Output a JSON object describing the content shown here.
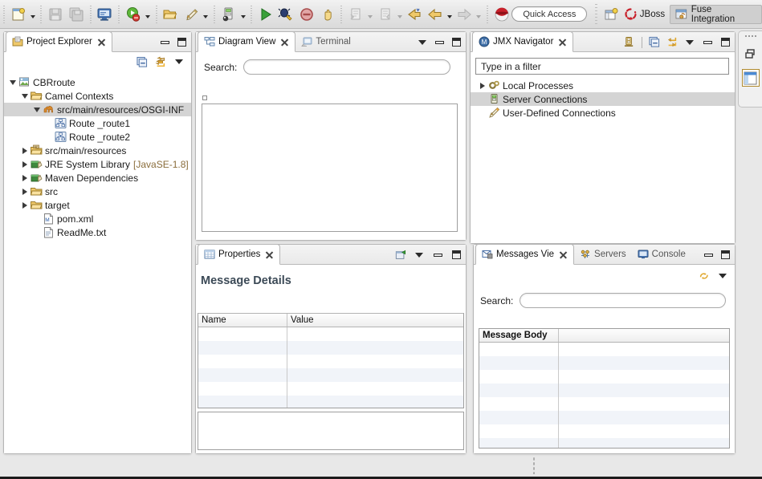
{
  "toolbar": {
    "buttons": [
      {
        "name": "new-wizard",
        "icon": "new-file-icon",
        "has_arrow": true,
        "enabled": true
      },
      {
        "name": "save",
        "icon": "save-icon",
        "has_arrow": false,
        "enabled": false
      },
      {
        "name": "save-all",
        "icon": "save-all-icon",
        "has_arrow": false,
        "enabled": false
      },
      {
        "name": "open-console",
        "icon": "console-icon",
        "has_arrow": false,
        "enabled": true
      },
      {
        "name": "run",
        "icon": "run-server-icon",
        "has_arrow": true,
        "enabled": true
      },
      {
        "name": "open-type",
        "icon": "open-folder-icon",
        "has_arrow": false,
        "enabled": true
      },
      {
        "name": "edit",
        "icon": "pencil-icon",
        "has_arrow": true,
        "enabled": true
      },
      {
        "name": "database",
        "icon": "database-icon",
        "has_arrow": true,
        "enabled": true
      },
      {
        "name": "run-green",
        "icon": "run-icon",
        "has_arrow": false,
        "enabled": true
      },
      {
        "name": "debug",
        "icon": "debug-icon",
        "has_arrow": false,
        "enabled": true
      },
      {
        "name": "terminate",
        "icon": "terminate-icon",
        "has_arrow": false,
        "enabled": true
      },
      {
        "name": "suspend",
        "icon": "hand-icon",
        "has_arrow": false,
        "enabled": true
      },
      {
        "name": "next-annotation",
        "icon": "next-annotation-icon",
        "has_arrow": true,
        "enabled": false
      },
      {
        "name": "previous-annotation",
        "icon": "previous-annotation-icon",
        "has_arrow": true,
        "enabled": false
      },
      {
        "name": "last-edit-location",
        "icon": "last-edit-icon",
        "has_arrow": false,
        "enabled": true
      },
      {
        "name": "back",
        "icon": "back-arrow-icon",
        "has_arrow": true,
        "enabled": true
      },
      {
        "name": "forward",
        "icon": "forward-arrow-icon",
        "has_arrow": true,
        "enabled": false
      },
      {
        "name": "jboss-logo",
        "icon": "jboss-hat-icon",
        "has_arrow": false,
        "enabled": true
      }
    ],
    "quick_access": "Quick Access",
    "open-perspective": "open-perspective-icon",
    "perspectives": [
      {
        "label": "JBoss",
        "icon": "jboss-icon",
        "active": false
      },
      {
        "label": "Fuse Integration",
        "icon": "fuse-icon",
        "active": true
      }
    ]
  },
  "project_explorer": {
    "tab": "Project Explorer",
    "toolbar_icons": [
      "collapse-all-icon",
      "link-with-editor-icon",
      "view-menu-icon"
    ],
    "tree": [
      {
        "label": "CBRroute",
        "indent": 0,
        "twisty": "down",
        "icon": "project-icon",
        "selected": false
      },
      {
        "label": "Camel Contexts",
        "indent": 1,
        "twisty": "down",
        "icon": "folder-open-icon",
        "selected": false
      },
      {
        "label": "src/main/resources/OSGI-INF",
        "indent": 2,
        "twisty": "down",
        "icon": "camel-icon",
        "selected": true
      },
      {
        "label": "Route _route1",
        "indent": 3,
        "twisty": "none",
        "icon": "route-icon",
        "selected": false
      },
      {
        "label": "Route _route2",
        "indent": 3,
        "twisty": "none",
        "icon": "route-icon",
        "selected": false
      },
      {
        "label": "src/main/resources",
        "indent": 1,
        "twisty": "right",
        "icon": "source-folder-icon",
        "selected": false
      },
      {
        "label": "JRE System Library",
        "suffix": "[JavaSE-1.8]",
        "indent": 1,
        "twisty": "right",
        "icon": "library-icon",
        "selected": false
      },
      {
        "label": "Maven Dependencies",
        "indent": 1,
        "twisty": "right",
        "icon": "library-icon",
        "selected": false
      },
      {
        "label": "src",
        "indent": 1,
        "twisty": "right",
        "icon": "folder-icon",
        "selected": false
      },
      {
        "label": "target",
        "indent": 1,
        "twisty": "right",
        "icon": "folder-icon",
        "selected": false
      },
      {
        "label": "pom.xml",
        "indent": 2,
        "twisty": "none",
        "icon": "maven-file-icon",
        "selected": false
      },
      {
        "label": "ReadMe.txt",
        "indent": 2,
        "twisty": "none",
        "icon": "text-file-icon",
        "selected": false
      }
    ]
  },
  "diagram_view": {
    "tabs": [
      {
        "label": "Diagram View",
        "icon": "diagram-icon",
        "active": true,
        "closable": true
      },
      {
        "label": "Terminal",
        "icon": "terminal-icon",
        "active": false,
        "closable": false
      }
    ],
    "search_label": "Search:",
    "search_value": "",
    "search_placeholder": ""
  },
  "jmx_navigator": {
    "tab": "JMX Navigator",
    "toolbar_icons": [
      "new-connection-icon",
      "collapse-all-icon",
      "link-icon",
      "view-menu-icon"
    ],
    "filter_placeholder": "Type in a filter",
    "filter_value": "Type in a filter",
    "tree": [
      {
        "label": "Local Processes",
        "twisty": "right",
        "icon": "gears-icon",
        "selected": false
      },
      {
        "label": "Server Connections",
        "twisty": "none",
        "icon": "server-icon",
        "selected": true
      },
      {
        "label": "User-Defined Connections",
        "twisty": "none",
        "icon": "pencil-icon",
        "selected": false
      }
    ]
  },
  "properties": {
    "tab": "Properties",
    "toolbar_icons": [
      "pin-icon",
      "view-menu-icon",
      "minimize-icon",
      "maximize-icon"
    ],
    "section_title": "Message Details",
    "columns": [
      "Name",
      "Value"
    ],
    "rows": [
      {
        "name": "",
        "value": ""
      },
      {
        "name": "",
        "value": ""
      },
      {
        "name": "",
        "value": ""
      },
      {
        "name": "",
        "value": ""
      },
      {
        "name": "",
        "value": ""
      },
      {
        "name": "",
        "value": ""
      },
      {
        "name": "",
        "value": ""
      }
    ]
  },
  "messages_view": {
    "tabs": [
      {
        "label": "Messages Vie",
        "icon": "messages-icon",
        "active": true,
        "closable": true
      },
      {
        "label": "Servers",
        "icon": "servers-icon",
        "active": false,
        "closable": false
      },
      {
        "label": "Console",
        "icon": "console-icon",
        "active": false,
        "closable": false
      }
    ],
    "toolbar_icons": [
      "refresh-icon",
      "view-menu-icon"
    ],
    "search_label": "Search:",
    "search_value": "",
    "columns": [
      "Message Body",
      ""
    ],
    "rows": [
      {
        "body": ""
      },
      {
        "body": ""
      },
      {
        "body": ""
      },
      {
        "body": ""
      },
      {
        "body": ""
      },
      {
        "body": ""
      },
      {
        "body": ""
      },
      {
        "body": ""
      },
      {
        "body": ""
      }
    ]
  },
  "fastview_bar": {
    "icons": [
      "restore-icon",
      "perspective-layout-icon"
    ]
  },
  "colors": {
    "selection": "#d4d4d4",
    "stripe": "#f1f4f9",
    "chrome": "#e3e3e3",
    "accent_orange": "#e8a33d",
    "jboss_red": "#c8202a",
    "section_title": "#3c4a57"
  }
}
